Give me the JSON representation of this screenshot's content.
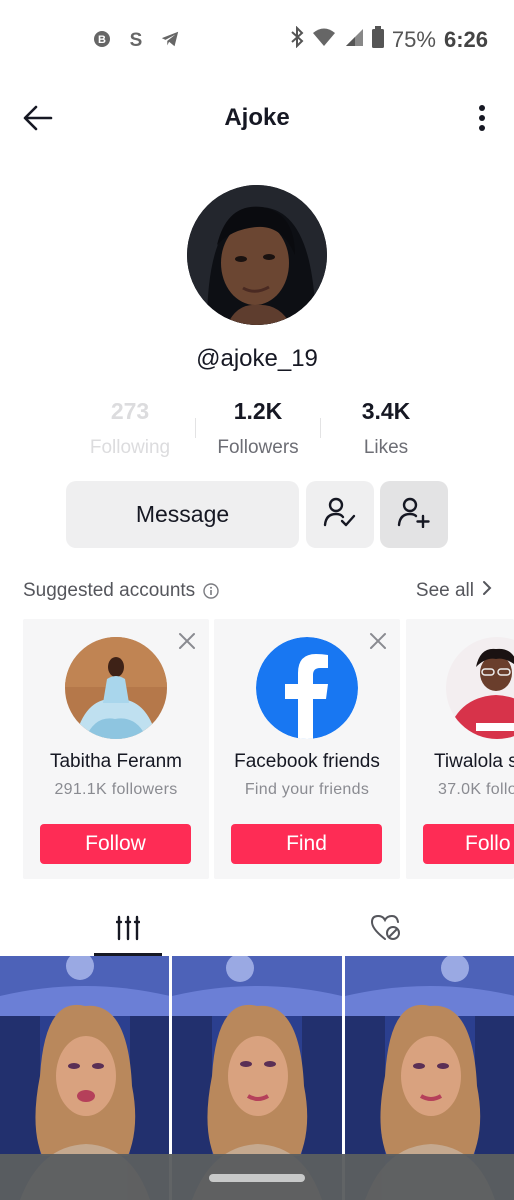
{
  "status_bar": {
    "battery_percent": "75%",
    "time": "6:26",
    "left_icons": [
      "bitcoin-icon",
      "dollar-app-icon",
      "telegram-icon"
    ],
    "right_icons": [
      "bluetooth-icon",
      "wifi-icon",
      "signal-icon",
      "battery-icon"
    ]
  },
  "header": {
    "title": "Ajoke"
  },
  "profile": {
    "username": "@ajoke_19",
    "stats": [
      {
        "value": "273",
        "label": "Following"
      },
      {
        "value": "1.2K",
        "label": "Followers"
      },
      {
        "value": "3.4K",
        "label": "Likes"
      }
    ]
  },
  "actions": {
    "message_label": "Message"
  },
  "suggested": {
    "title": "Suggested accounts",
    "see_all": "See all",
    "cards": [
      {
        "name": "Tabitha Feranm",
        "subtitle": "291.1K followers",
        "button": "Follow"
      },
      {
        "name": "Facebook friends",
        "subtitle": "Find your friends",
        "button": "Find"
      },
      {
        "name": "Tiwalola s",
        "subtitle": "37.0K follo",
        "button": "Follo"
      }
    ]
  },
  "colors": {
    "accent": "#fe2c55",
    "facebook": "#1877f2",
    "text_primary": "#161823",
    "text_secondary": "#6d6e75"
  }
}
